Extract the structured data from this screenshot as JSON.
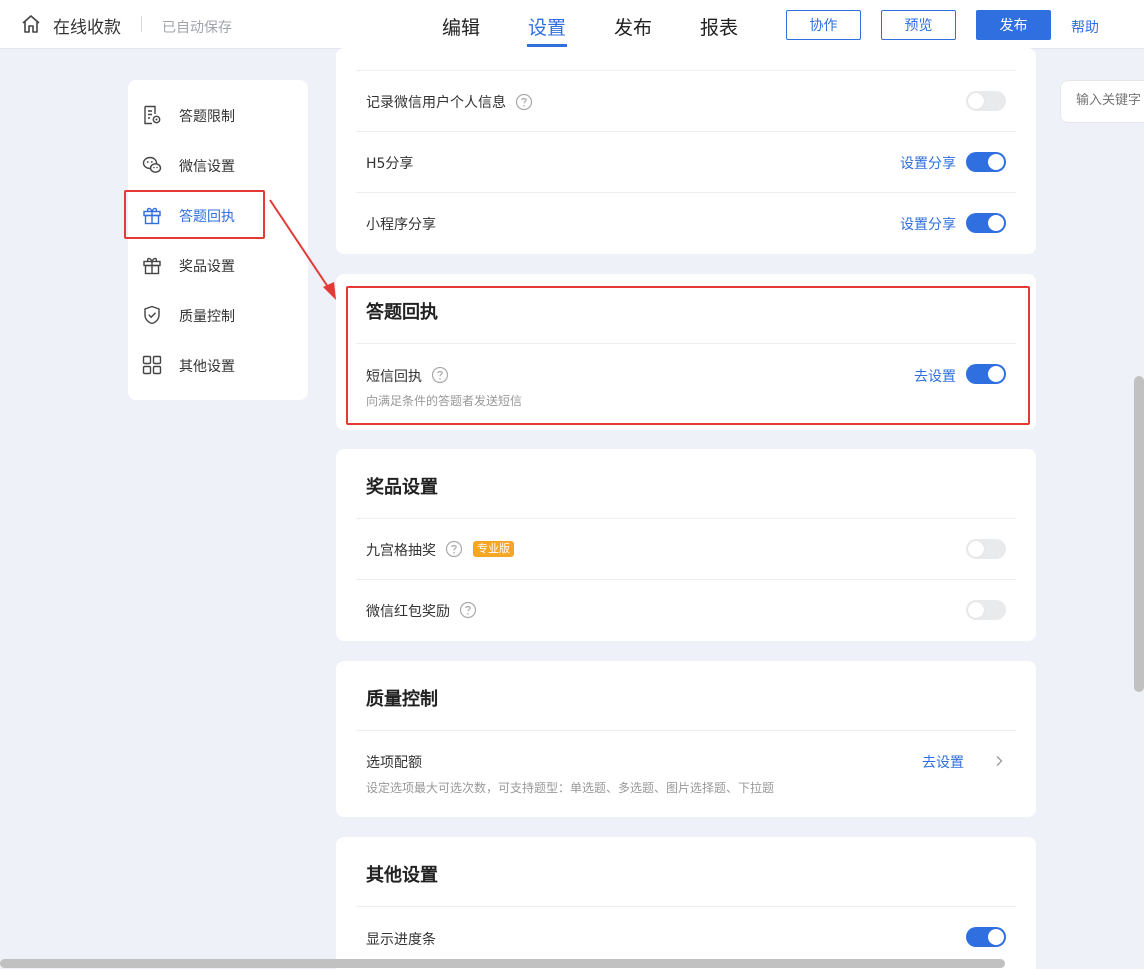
{
  "header": {
    "title": "在线收款",
    "autosave": "已自动保存",
    "tabs": [
      {
        "label": "编辑"
      },
      {
        "label": "设置"
      },
      {
        "label": "发布"
      },
      {
        "label": "报表"
      }
    ],
    "buttons": {
      "collab": "协作",
      "preview": "预览",
      "publish": "发布"
    },
    "help": "帮助",
    "accent_color": "#2f6fdf"
  },
  "sidebar": {
    "items": [
      {
        "label": "答题限制",
        "icon": "document-settings-icon"
      },
      {
        "label": "微信设置",
        "icon": "wechat-icon"
      },
      {
        "label": "答题回执",
        "icon": "gift-icon"
      },
      {
        "label": "奖品设置",
        "icon": "gift-icon"
      },
      {
        "label": "质量控制",
        "icon": "shield-check-icon"
      },
      {
        "label": "其他设置",
        "icon": "grid-icon"
      }
    ],
    "active_index": 2
  },
  "wechat_card": {
    "rows": [
      {
        "label": "记录微信用户个人信息",
        "has_help": true,
        "link": "",
        "toggle": false
      },
      {
        "label": "H5分享",
        "has_help": false,
        "link": "设置分享",
        "toggle": true
      },
      {
        "label": "小程序分享",
        "has_help": false,
        "link": "设置分享",
        "toggle": true
      }
    ]
  },
  "receipt_card": {
    "title": "答题回执",
    "rows": [
      {
        "label": "短信回执",
        "desc": "向满足条件的答题者发送短信",
        "link": "去设置",
        "toggle": true
      }
    ]
  },
  "prize_card": {
    "title": "奖品设置",
    "rows": [
      {
        "label": "九宫格抽奖",
        "badge": "专业版",
        "toggle": false
      },
      {
        "label": "微信红包奖励",
        "toggle": false
      }
    ]
  },
  "quality_card": {
    "title": "质量控制",
    "rows": [
      {
        "label": "选项配额",
        "desc": "设定选项最大可选次数，可支持题型：单选题、多选题、图片选择题、下拉题",
        "link": "去设置"
      }
    ]
  },
  "other_card": {
    "title": "其他设置",
    "rows": [
      {
        "label": "显示进度条",
        "toggle": true
      }
    ]
  },
  "search": {
    "placeholder": "输入关键字"
  },
  "colors": {
    "highlight": "#e53935",
    "badge": "#f5a623"
  }
}
